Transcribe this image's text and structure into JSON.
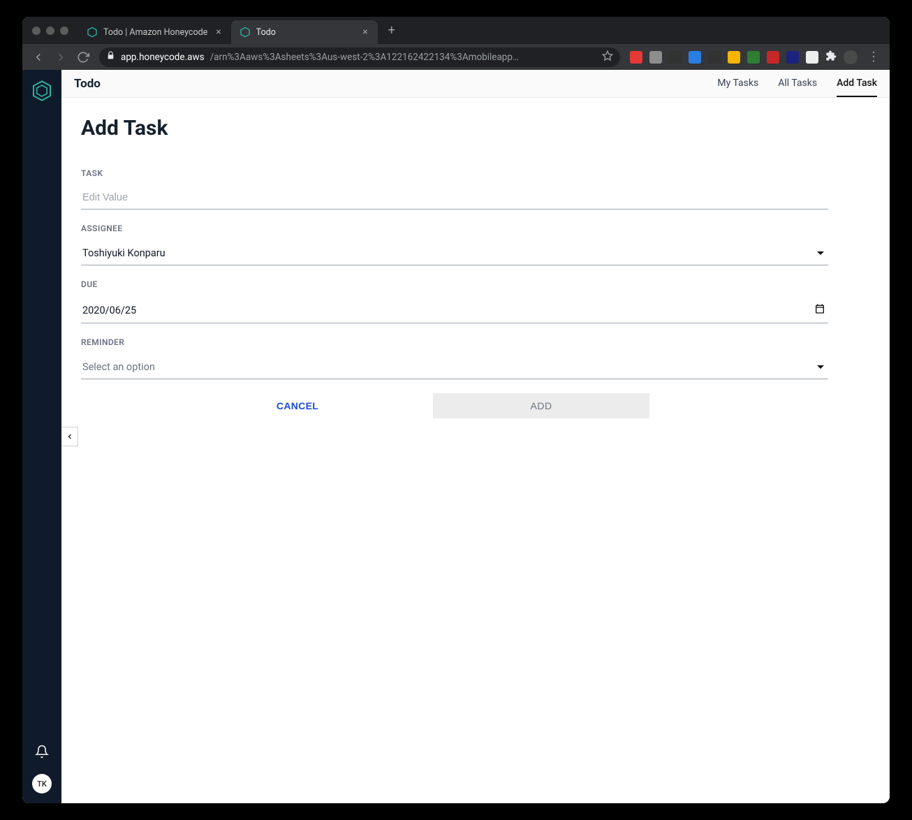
{
  "browser": {
    "tabs": [
      {
        "title": "Todo | Amazon Honeycode",
        "active": false
      },
      {
        "title": "Todo",
        "active": true
      }
    ],
    "url_host": "app.honeycode.aws",
    "url_path": "/arn%3Aaws%3Asheets%3Aus-west-2%3A122162422134%3Amobileapp…",
    "ext_colors": [
      "#e53935",
      "#8d8d8d",
      "#323232",
      "#2a7de1",
      "#323232",
      "#f7b500",
      "#2e7d32",
      "#c62828",
      "#1a237e",
      "#eeeeee",
      "#ffffff"
    ]
  },
  "sidebar": {
    "user_initials": "TK"
  },
  "header": {
    "app_title": "Todo",
    "nav": [
      {
        "label": "My Tasks",
        "active": false
      },
      {
        "label": "All Tasks",
        "active": false
      },
      {
        "label": "Add Task",
        "active": true
      }
    ]
  },
  "page": {
    "title": "Add Task",
    "fields": {
      "task": {
        "label": "TASK",
        "placeholder": "Edit Value",
        "value": ""
      },
      "assignee": {
        "label": "ASSIGNEE",
        "value": "Toshiyuki Konparu"
      },
      "due": {
        "label": "DUE",
        "value": "2020/06/25"
      },
      "reminder": {
        "label": "REMINDER",
        "placeholder": "Select an option",
        "value": ""
      }
    },
    "buttons": {
      "cancel": "CANCEL",
      "add": "ADD"
    }
  }
}
